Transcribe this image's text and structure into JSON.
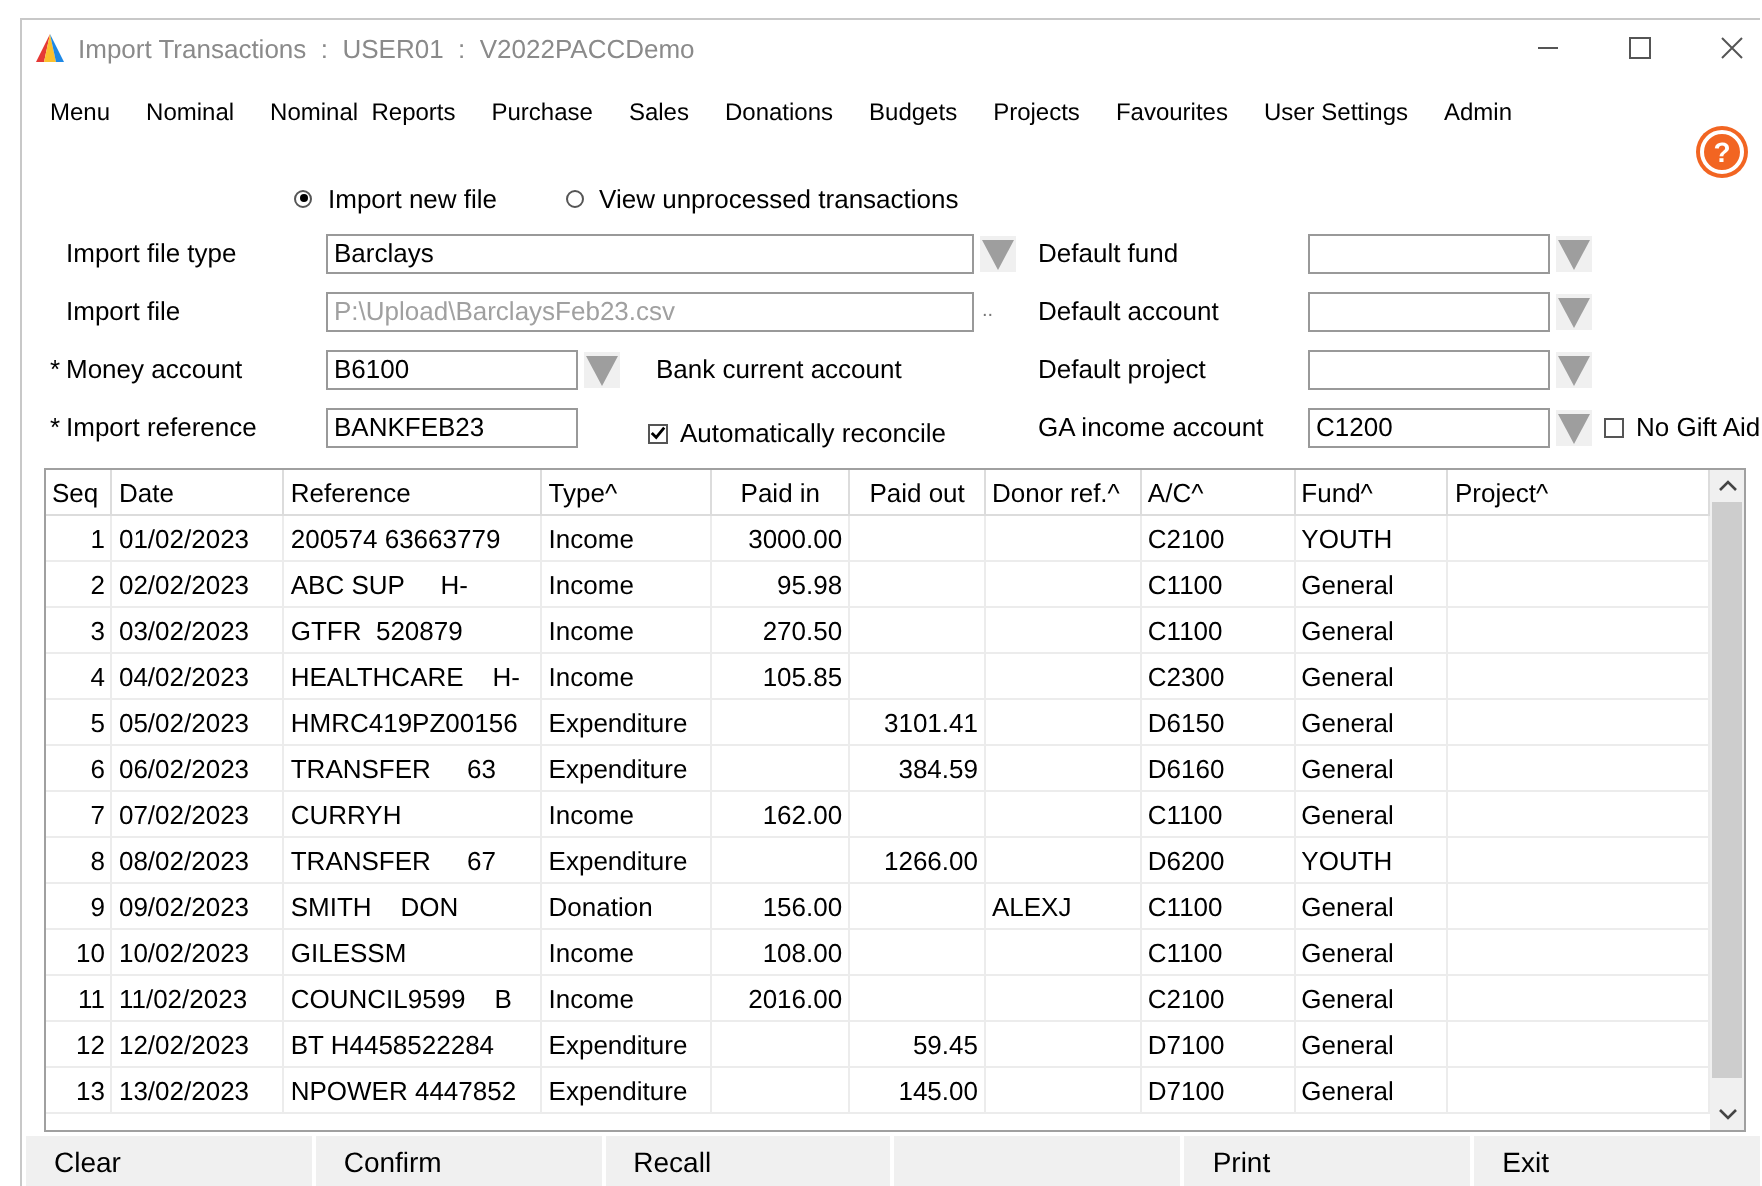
{
  "window": {
    "title": "Import Transactions  :  USER01  :  V2022PACCDemo"
  },
  "menu": [
    "Menu",
    "Nominal",
    "Nominal  Reports",
    "Purchase",
    "Sales",
    "Donations",
    "Budgets",
    "Projects",
    "Favourites",
    "User Settings",
    "Admin"
  ],
  "help": {
    "symbol": "?"
  },
  "import_mode": [
    {
      "label": "Import new file",
      "selected": true
    },
    {
      "label": "View unprocessed transactions",
      "selected": false
    }
  ],
  "form_rows": [
    {
      "left": {
        "label": "Import file type",
        "kind": "wide-dropdown",
        "value": "Barclays"
      },
      "right": {
        "label": "Default fund"
      }
    },
    {
      "left": {
        "label": "Import file",
        "kind": "file",
        "value": "P:\\Upload\\BarclaysFeb23.csv",
        "disabled": true,
        "browse": ".."
      },
      "right": {
        "label": "Default account"
      }
    },
    {
      "left": {
        "marker": "*",
        "label": "Money account",
        "kind": "short-dropdown",
        "value": "B6100",
        "note": "Bank current account"
      },
      "right": {
        "label": "Default project"
      }
    },
    {
      "left": {
        "marker": "*",
        "label": "Import reference",
        "kind": "short-text",
        "value": "BANKFEB23",
        "checkbox": {
          "label": "Automatically reconcile",
          "checked": true
        }
      },
      "right": {
        "label": "GA income account",
        "value": "C1200",
        "checkbox": {
          "label": "No Gift Aid",
          "checked": false
        }
      }
    }
  ],
  "table": {
    "columns": [
      "Seq",
      "Date",
      "Reference",
      "Type^",
      "Paid in",
      "Paid out",
      "Donor ref.^",
      "A/C^",
      "Fund^",
      "Project^"
    ],
    "rows": [
      [
        "1",
        "01/02/2023",
        "200574 63663779",
        "Income",
        "3000.00",
        "",
        "",
        "C2100",
        "YOUTH",
        ""
      ],
      [
        "2",
        "02/02/2023",
        "ABC SUP     H-",
        "Income",
        "95.98",
        "",
        "",
        "C1100",
        "General",
        ""
      ],
      [
        "3",
        "03/02/2023",
        "GTFR  520879",
        "Income",
        "270.50",
        "",
        "",
        "C1100",
        "General",
        ""
      ],
      [
        "4",
        "04/02/2023",
        "HEALTHCARE    H-",
        "Income",
        "105.85",
        "",
        "",
        "C2300",
        "General",
        ""
      ],
      [
        "5",
        "05/02/2023",
        "HMRC419PZ00156",
        "Expenditure",
        "",
        "3101.41",
        "",
        "D6150",
        "General",
        ""
      ],
      [
        "6",
        "06/02/2023",
        "TRANSFER     63",
        "Expenditure",
        "",
        "384.59",
        "",
        "D6160",
        "General",
        ""
      ],
      [
        "7",
        "07/02/2023",
        "CURRYH",
        "Income",
        "162.00",
        "",
        "",
        "C1100",
        "General",
        ""
      ],
      [
        "8",
        "08/02/2023",
        "TRANSFER     67",
        "Expenditure",
        "",
        "1266.00",
        "",
        "D6200",
        "YOUTH",
        ""
      ],
      [
        "9",
        "09/02/2023",
        "SMITH    DON",
        "Donation",
        "156.00",
        "",
        "ALEXJ",
        "C1100",
        "General",
        ""
      ],
      [
        "10",
        "10/02/2023",
        "GILESSM",
        "Income",
        "108.00",
        "",
        "",
        "C1100",
        "General",
        ""
      ],
      [
        "11",
        "11/02/2023",
        "COUNCIL9599    B",
        "Income",
        "2016.00",
        "",
        "",
        "C2100",
        "General",
        ""
      ],
      [
        "12",
        "12/02/2023",
        "BT H4458522284",
        "Expenditure",
        "",
        "59.45",
        "",
        "D7100",
        "General",
        ""
      ],
      [
        "13",
        "13/02/2023",
        "NPOWER 4447852",
        "Expenditure",
        "",
        "145.00",
        "",
        "D7100",
        "General",
        ""
      ]
    ]
  },
  "buttons": [
    {
      "label": "Clear"
    },
    {
      "label": "Confirm"
    },
    {
      "label": "Recall"
    },
    {
      "kind": "blank"
    },
    {
      "label": "Print"
    },
    {
      "label": "Exit"
    }
  ]
}
